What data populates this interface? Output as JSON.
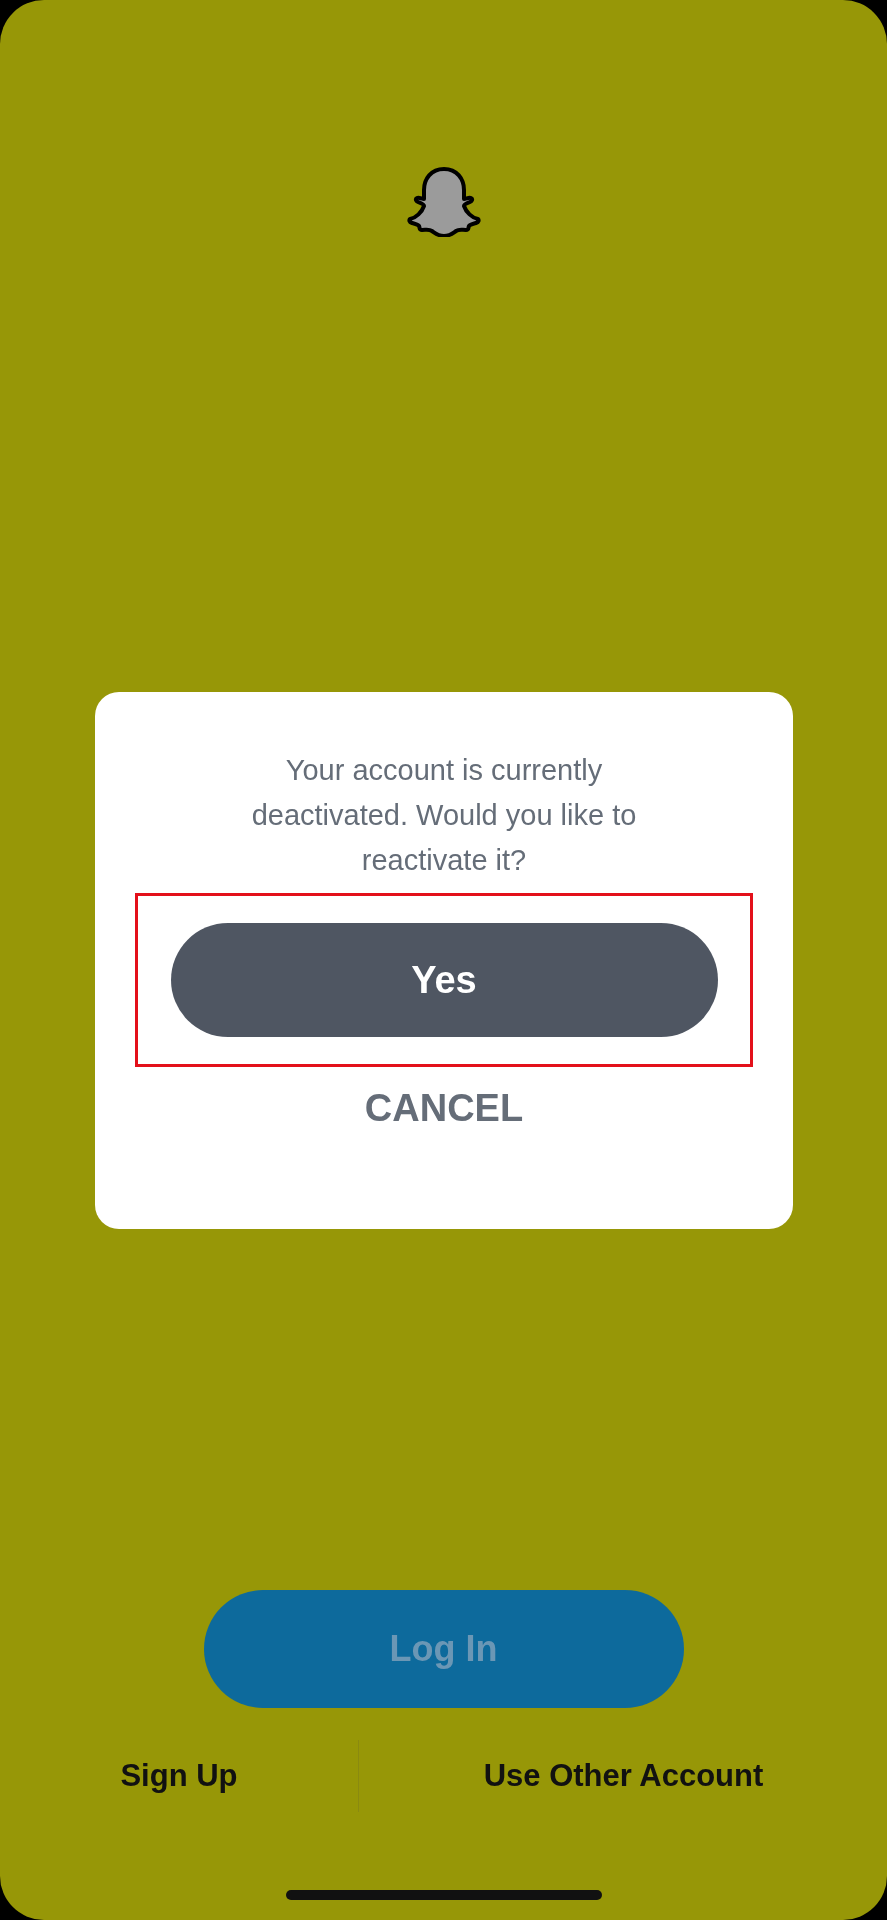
{
  "dialog": {
    "message": "Your account is currently deactivated. Would you like to reactivate it?",
    "confirm": {
      "label": "Yes",
      "highlighted": true
    },
    "cancel": {
      "label": "CANCEL"
    }
  },
  "login_button": {
    "label": "Log In",
    "disabled": true
  },
  "bottom_links": [
    {
      "label": "Sign Up"
    },
    {
      "label": "Use Other Account"
    }
  ]
}
